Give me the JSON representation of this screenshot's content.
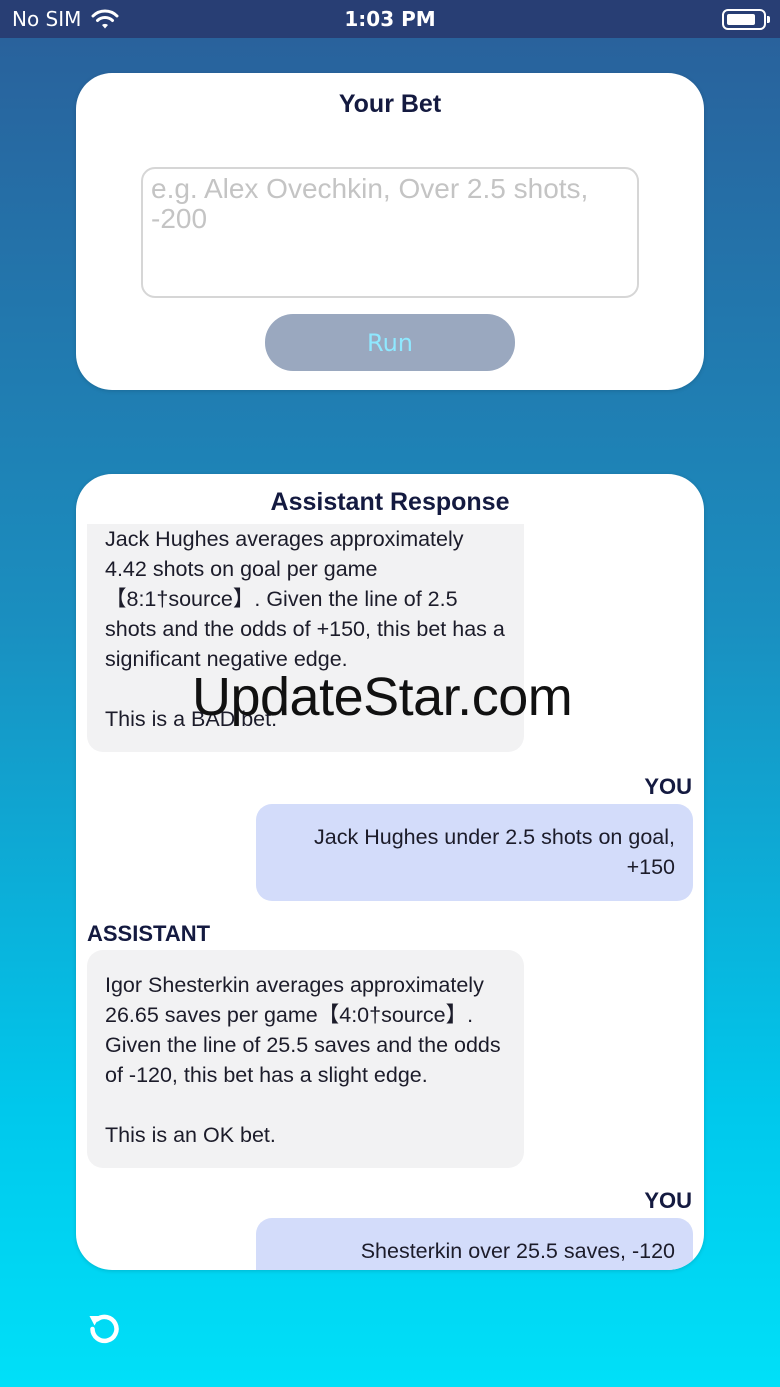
{
  "status_bar": {
    "carrier": "No SIM",
    "time": "1:03 PM"
  },
  "bet_card": {
    "title": "Your Bet",
    "input_placeholder": "e.g. Alex Ovechkin, Over 2.5 shots, -200",
    "input_value": "",
    "run_label": "Run"
  },
  "response_card": {
    "title": "Assistant Response",
    "messages": [
      {
        "role": "assistant",
        "label": "",
        "text": "Jack Hughes averages approximately 4.42 shots on goal per game【8:1†source】. Given the line of 2.5 shots and the odds of +150, this bet has a significant negative edge.\n\nThis is a BAD bet."
      },
      {
        "role": "user",
        "label": "YOU",
        "text": "Jack Hughes under 2.5 shots on goal, +150"
      },
      {
        "role": "assistant",
        "label": "ASSISTANT",
        "text": "Igor Shesterkin averages approximately 26.65 saves per game【4:0†source】. Given the line of 25.5 saves and the odds of -120, this bet has a slight edge.\n\nThis is an OK bet."
      },
      {
        "role": "user",
        "label": "YOU",
        "text": "Shesterkin over 25.5 saves, -120"
      }
    ]
  },
  "watermark": "UpdateStar.com",
  "icons": {
    "wifi": "wifi-icon",
    "battery": "battery-icon",
    "reset": "refresh-icon"
  },
  "colors": {
    "status_bar": "#283e74",
    "title": "#141a40",
    "user_bubble": "#d3dcfa",
    "assistant_bubble": "#f2f2f3",
    "run_button": "#9aa8bf",
    "run_text": "#8fe8ff"
  }
}
